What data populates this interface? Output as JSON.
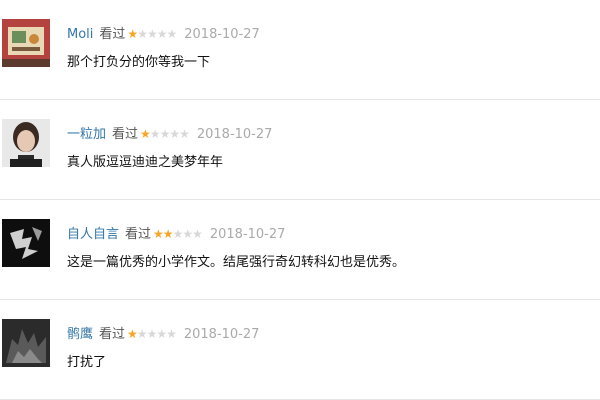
{
  "reviews": [
    {
      "username": "Moli",
      "status": "看过",
      "rating": 1,
      "max_rating": 5,
      "date": "2018-10-27",
      "comment": "那个打负分的你等我一下"
    },
    {
      "username": "一粒加",
      "status": "看过",
      "rating": 1,
      "max_rating": 5,
      "date": "2018-10-27",
      "comment": "真人版逗逗迪迪之美梦年年"
    },
    {
      "username": "自人自言",
      "status": "看过",
      "rating": 2,
      "max_rating": 5,
      "date": "2018-10-27",
      "comment": "这是一篇优秀的小学作文。结尾强行奇幻转科幻也是优秀。"
    },
    {
      "username": "鹘鹰",
      "status": "看过",
      "rating": 1,
      "max_rating": 5,
      "date": "2018-10-27",
      "comment": "打扰了"
    }
  ],
  "colors": {
    "username": "#3377aa",
    "star_on": "#f5a623",
    "star_off": "#d8d8d8",
    "date": "#aaaaaa"
  }
}
